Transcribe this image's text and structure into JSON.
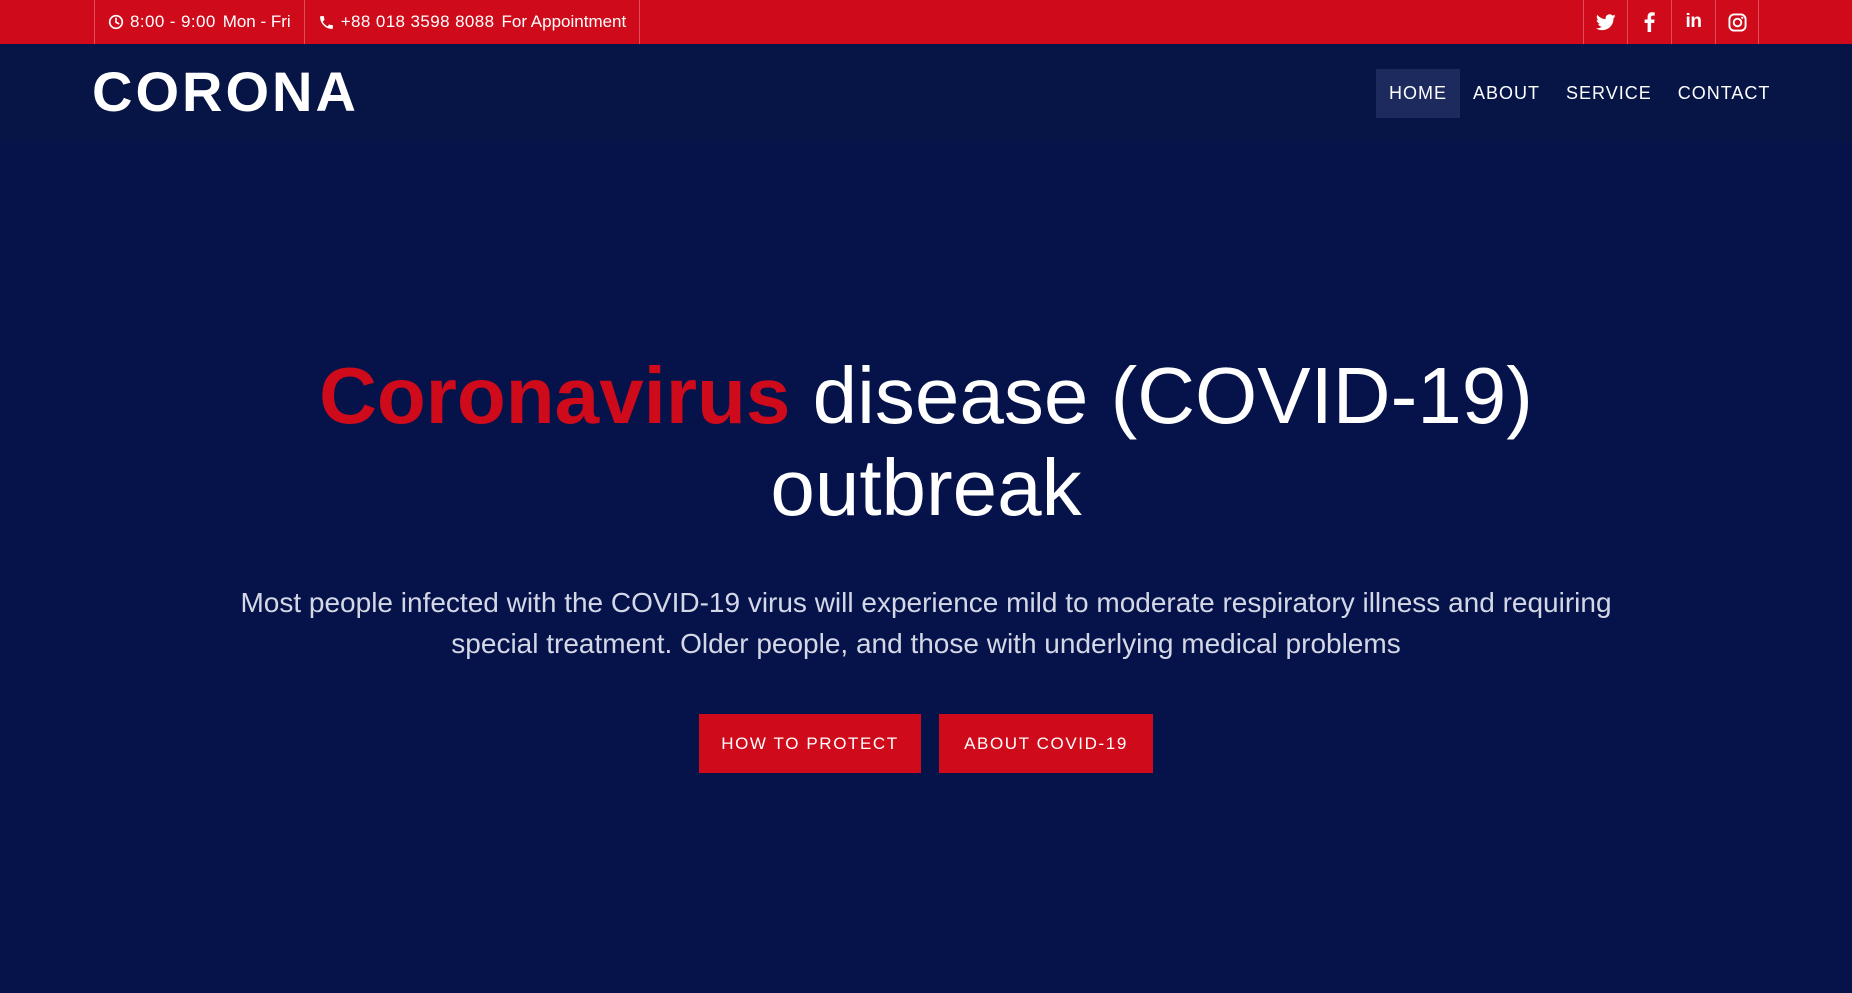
{
  "topbar": {
    "hours_time": "8:00 - 9:00",
    "hours_days": "Mon - Fri",
    "phone_number": "+88 018 3598 8088",
    "phone_note": "For Appointment",
    "social": [
      {
        "icon": "twitter-icon"
      },
      {
        "icon": "facebook-icon"
      },
      {
        "icon": "linkedin-icon",
        "label": "in"
      },
      {
        "icon": "instagram-icon"
      }
    ]
  },
  "header": {
    "logo": "CORONA",
    "nav": [
      {
        "label": "HOME",
        "active": true
      },
      {
        "label": "ABOUT",
        "active": false
      },
      {
        "label": "SERVICE",
        "active": false
      },
      {
        "label": "CONTACT",
        "active": false
      }
    ]
  },
  "hero": {
    "title_accent": "Coronavirus",
    "title_rest": "disease (COVID-19) outbreak",
    "text": "Most people infected with the COVID-19 virus will experience mild to moderate respiratory illness and requiring special treatment. Older people, and those with underlying medical problems",
    "buttons": [
      {
        "label": "HOW TO PROTECT"
      },
      {
        "label": "ABOUT COVID-19"
      }
    ]
  },
  "colors": {
    "accent": "#cf0b1b",
    "background": "#06134a",
    "header": "#061546",
    "nav_active": "#1c2a5e"
  }
}
